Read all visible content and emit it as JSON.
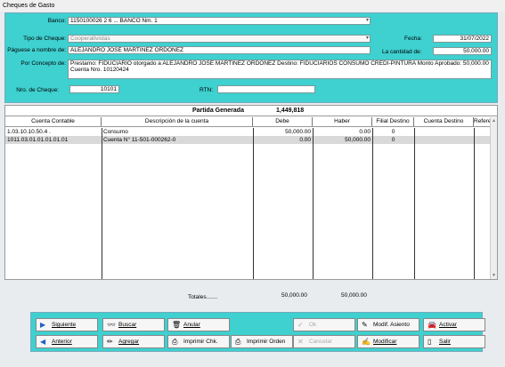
{
  "window": {
    "title": "Cheques de Gasto"
  },
  "form": {
    "banco_label": "Banco:",
    "banco_value": "1150100026 2 6 ...           BANCO Nm. 1",
    "tipo_label": "Tipo de Cheque:",
    "tipo_value": "Cooperativistas",
    "fecha_label": "Fecha:",
    "fecha_value": "31/07/2022",
    "pagese_label": "Páguese a nombre de:",
    "pagese_value": "ALEJANDRO JOSE MARTINEZ ORDOÑEZ",
    "cantidad_label": "La cantidad de:",
    "cantidad_value": "50,000.00",
    "concepto_label": "Por Concepto de:",
    "concepto_value": "Prestamo: FIDUCIARIO otorgado a ALEJANDRO JOSE MARTINEZ ORDOÑEZ Destino: FIDUCIARIOS CONSUMO CREDI-PINTURA Monto Aprobado: 50,000.00 Cuenta Nro. 10120424",
    "nro_label": "Nro. de Cheque:",
    "nro_value": "10101",
    "rtn_label": "RTN:",
    "rtn_value": ""
  },
  "grid": {
    "caption": "Partida Generada",
    "caption_total": "1,449,818",
    "columns": [
      "Cuenta Contable",
      "Descripción de la cuenta",
      "Debe",
      "Haber",
      "Filial Destino",
      "Cuenta Destino",
      "Refere"
    ],
    "rows": [
      {
        "cuenta": "1.03.10.10.50.4 .",
        "descripcion": "Consumo",
        "debe": "50,000.00",
        "haber": "0.00",
        "filial": "0",
        "destino": ""
      },
      {
        "cuenta": "1011.03.01.01.01.01.01",
        "descripcion": "Cuenta N° 11-501-000262-0",
        "debe": "0.00",
        "haber": "50,000.00",
        "filial": "0",
        "destino": ""
      }
    ]
  },
  "totals": {
    "label": "Totales.......",
    "debe": "50,000.00",
    "haber": "50,000.00"
  },
  "buttons": {
    "siguiente": "Siguiente",
    "buscar": "Buscar",
    "anular": "Anular",
    "ok": "Ok",
    "modif_asiento": "Modif. Asiento",
    "activar": "Activar",
    "anterior": "Anterior",
    "agregar": "Agregar",
    "imprimir_chk": "Imprimir Chk.",
    "imprimir_orden": "Imprimir Orden",
    "cancelar": "Cancelar",
    "modificar": "Modificar",
    "salir": "Salir"
  },
  "icons": {
    "siguiente": "play-right-icon",
    "buscar": "binoculars-icon",
    "anular": "trash-icon",
    "ok": "checkmark-icon",
    "modif_asiento": "edit-entry-icon",
    "activar": "activate-car-icon",
    "anterior": "play-left-icon",
    "agregar": "add-pencil-icon",
    "imprimir_chk": "printer-icon",
    "imprimir_orden": "printer-icon",
    "cancelar": "cancel-x-icon",
    "modificar": "modify-icon",
    "salir": "exit-door-icon"
  },
  "colors": {
    "panel": "#3fd0d0",
    "background": "#e9ecef",
    "selected_row": "#d9d9d9"
  }
}
